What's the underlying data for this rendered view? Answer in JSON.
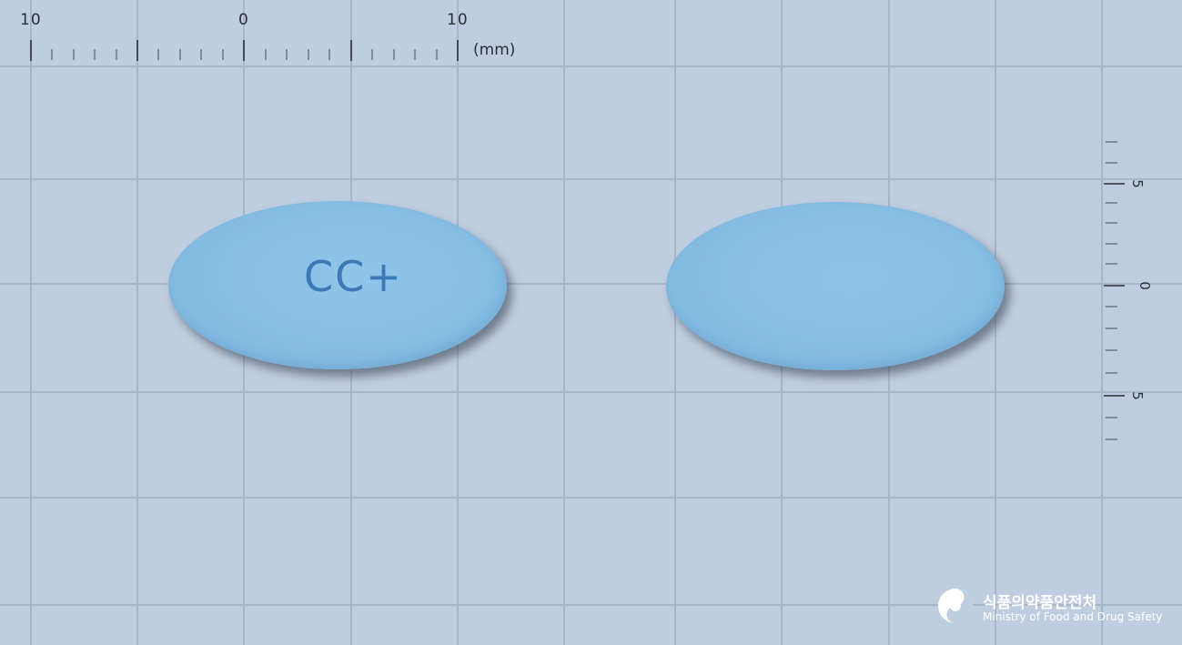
{
  "ruler_top": {
    "labels": [
      "10",
      "0",
      "10"
    ],
    "unit": "(mm)"
  },
  "ruler_right": {
    "labels": [
      "5",
      "0",
      "5"
    ]
  },
  "pills": [
    {
      "side": "front",
      "imprint": "CC+",
      "color": "#86bde4"
    },
    {
      "side": "back",
      "imprint": "",
      "color": "#86bde4"
    }
  ],
  "watermark": {
    "title_ko": "식품의약품안전처",
    "title_en": "Ministry of Food and Drug Safety",
    "icon": "taegeuk-swirl-icon"
  }
}
